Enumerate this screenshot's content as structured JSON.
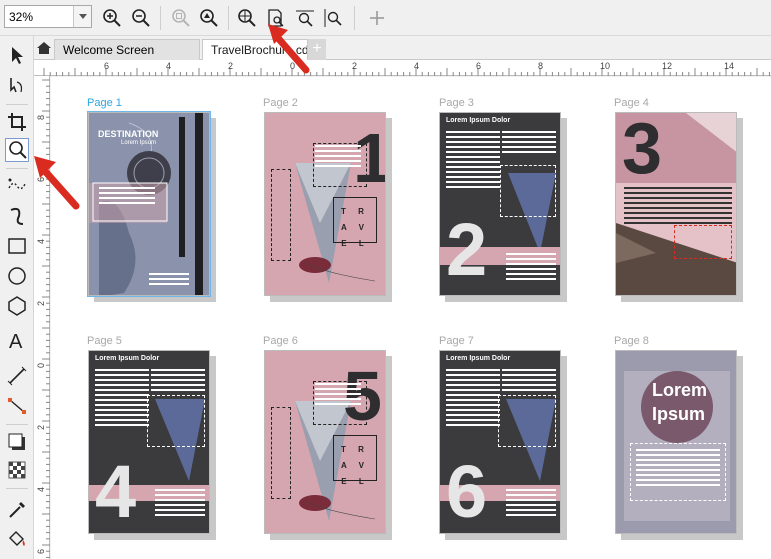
{
  "toolbar": {
    "zoom_value": "32%",
    "icons": [
      "zoom-in-icon",
      "zoom-out-icon",
      "zoom-to-selected-icon",
      "zoom-fit-icon",
      "zoom-all-objects-icon",
      "zoom-page-icon",
      "zoom-width-icon",
      "zoom-height-icon",
      "add-icon"
    ]
  },
  "tools": [
    "pick-tool",
    "shape-tool",
    "crop-tool",
    "zoom-tool",
    "freehand-tool",
    "artistic-media-tool",
    "rectangle-tool",
    "ellipse-tool",
    "polygon-tool",
    "text-tool",
    "dimension-tool",
    "connector-tool",
    "drop-shadow-tool",
    "transparency-tool",
    "eyedropper-tool",
    "fill-tool"
  ],
  "tabs": {
    "welcome": "Welcome Screen",
    "document": "TravelBrochure.cdr",
    "add": "+"
  },
  "ruler": {
    "h_labels": [
      "6",
      "4",
      "2",
      "0",
      "2",
      "4",
      "6",
      "8",
      "10",
      "12",
      "14"
    ],
    "v_labels": [
      "8",
      "6",
      "4",
      "2",
      "0",
      "2",
      "4",
      "6"
    ]
  },
  "pages": [
    {
      "label": "Page 1",
      "selected": true
    },
    {
      "label": "Page 2",
      "selected": false
    },
    {
      "label": "Page 3",
      "selected": false
    },
    {
      "label": "Page 4",
      "selected": false
    },
    {
      "label": "Page 5",
      "selected": false
    },
    {
      "label": "Page 6",
      "selected": false
    },
    {
      "label": "Page 7",
      "selected": false
    },
    {
      "label": "Page 8",
      "selected": false
    }
  ],
  "page_content": {
    "p1_title": "DESTINATION",
    "p1_sub": "Lorem Ipsum",
    "lorem_dolor": "Lorem Ipsum Dolor",
    "travel_word": "T R A V E L",
    "num2": "1",
    "num3": "2",
    "num4": "3",
    "num5": "4",
    "num6": "5",
    "num7": "6",
    "p8_title_line1": "Lorem",
    "p8_title_line2": "Ipsum"
  },
  "colors": {
    "pink": "#d6a6b0",
    "dark": "#3b3a3d",
    "accent": "#f4c7d0",
    "selection": "#2aa6e0",
    "callout": "#d92b1f"
  }
}
